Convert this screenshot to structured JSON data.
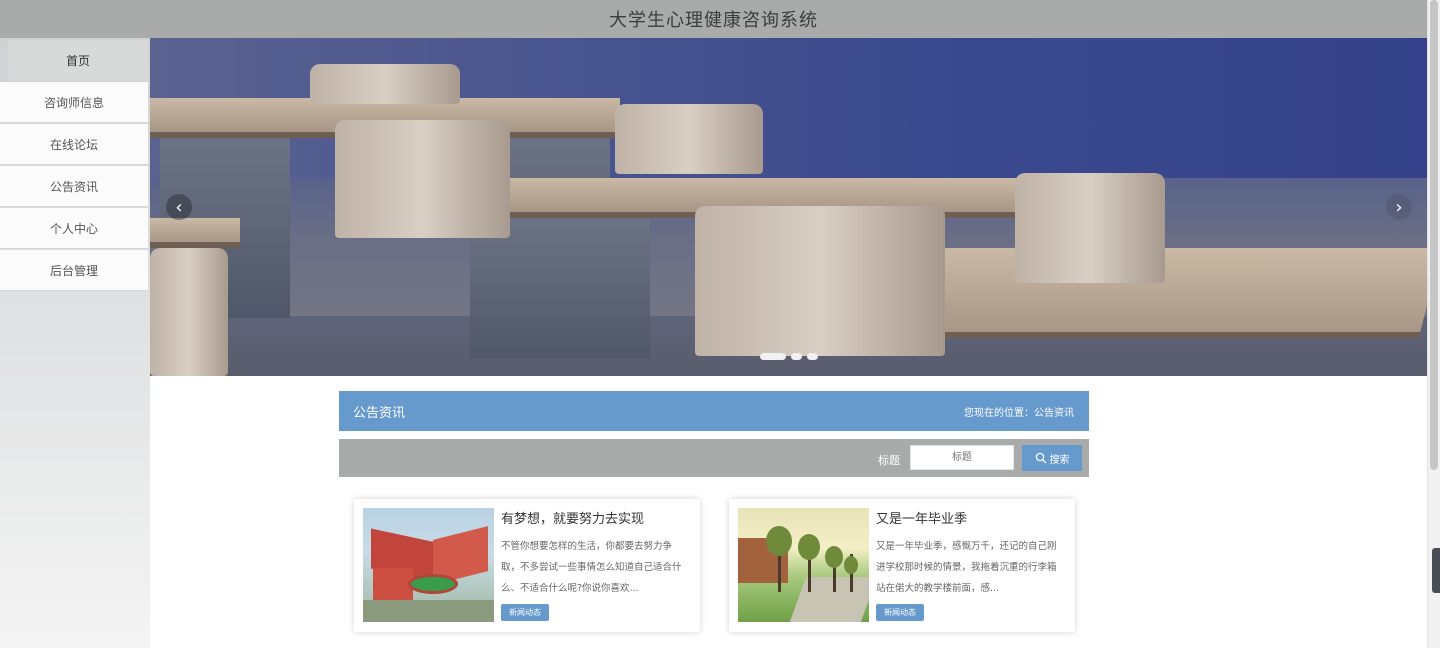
{
  "header": {
    "title": "大学生心理健康咨询系统"
  },
  "sidebar": {
    "items": [
      {
        "label": "首页",
        "active": true
      },
      {
        "label": "咨询师信息",
        "active": false
      },
      {
        "label": "在线论坛",
        "active": false
      },
      {
        "label": "公告资讯",
        "active": false
      },
      {
        "label": "个人中心",
        "active": false
      },
      {
        "label": "后台管理",
        "active": false
      }
    ]
  },
  "carousel": {
    "prev_icon": "‹",
    "next_icon": "›",
    "slide_count": 3,
    "active_index": 0
  },
  "section": {
    "title": "公告资讯",
    "breadcrumb": "您现在的位置：公告资讯"
  },
  "search": {
    "label": "标题",
    "placeholder": "标题",
    "button_label": "搜索",
    "button_icon": "search-icon"
  },
  "news": [
    {
      "title": "有梦想，就要努力去实现",
      "desc": "不管你想要怎样的生活，你都要去努力争取，不多尝试一些事情怎么知道自己适合什么、不适合什么呢?你说你喜欢...",
      "tag": "新闻动态"
    },
    {
      "title": "又是一年毕业季",
      "desc": "又是一年毕业季，感慨万千，还记的自己刚进学校那时候的情景，我拖着沉重的行李箱站在偌大的教学楼前面，感...",
      "tag": "新闻动态"
    }
  ],
  "colors": {
    "accent": "#6699cc",
    "topbar": "#a9abab"
  }
}
